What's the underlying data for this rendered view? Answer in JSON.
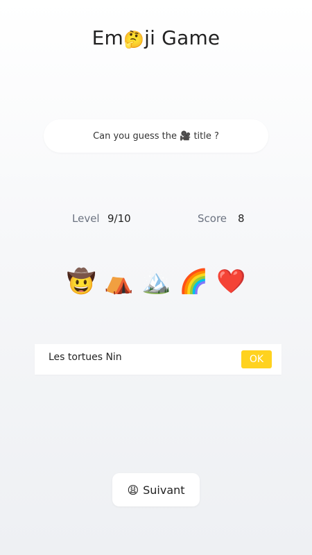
{
  "app": {
    "title_prefix": "Em",
    "title_emoji": "🤔",
    "title_suffix": "ji Game"
  },
  "question": {
    "text": "Can you guess the 🎥 title ?"
  },
  "stats": {
    "level_label": "Level",
    "level_value": "9/10",
    "score_label": "Score",
    "score_value": "8"
  },
  "emoji_clues": [
    "🤠",
    "⛺",
    "🏔️",
    "🌈",
    "❤️"
  ],
  "answer": {
    "value": "Les tortues Nin",
    "ok_label": "OK"
  },
  "next_button": {
    "emoji": "😩",
    "label": "Suivant"
  },
  "colors": {
    "accent": "#ffd21f",
    "label_gray": "#6b7280"
  }
}
